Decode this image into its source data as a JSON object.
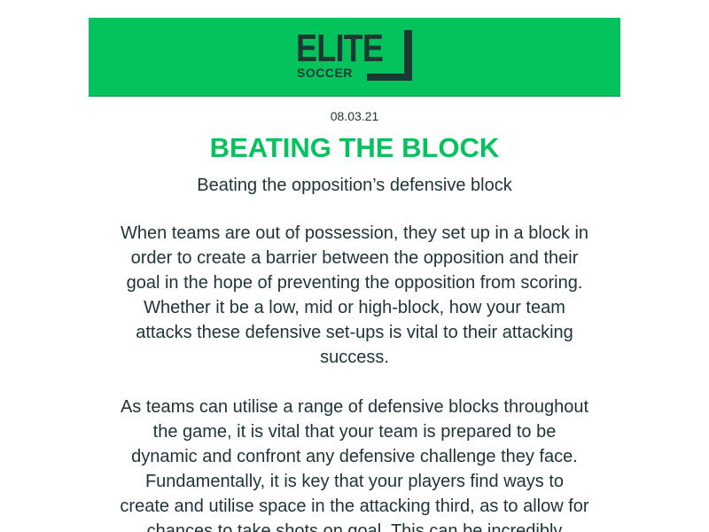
{
  "brand": {
    "logo_main": "ELITE",
    "logo_sub": "SOCCER",
    "banner_color": "#04c35c",
    "logo_color": "#1c3833"
  },
  "article": {
    "date": "08.03.21",
    "title": "BEATING THE BLOCK",
    "subtitle": "Beating the opposition’s defensive block",
    "paragraphs": [
      "When teams are out of possession, they set up in a block in order to create a barrier between the opposition and their goal in the hope of preventing the opposition from scoring. Whether it be a low, mid or high-block, how your team attacks these defensive set-ups is vital to their attacking success.",
      "As teams can utilise a range of defensive blocks throughout the game, it is vital that your team is prepared to be dynamic and confront any defensive challenge they face. Fundamentally, it is key that your players find ways to create and utilise space in the attacking third, as to allow for chances to take shots on goal. This can be incredibly"
    ]
  }
}
